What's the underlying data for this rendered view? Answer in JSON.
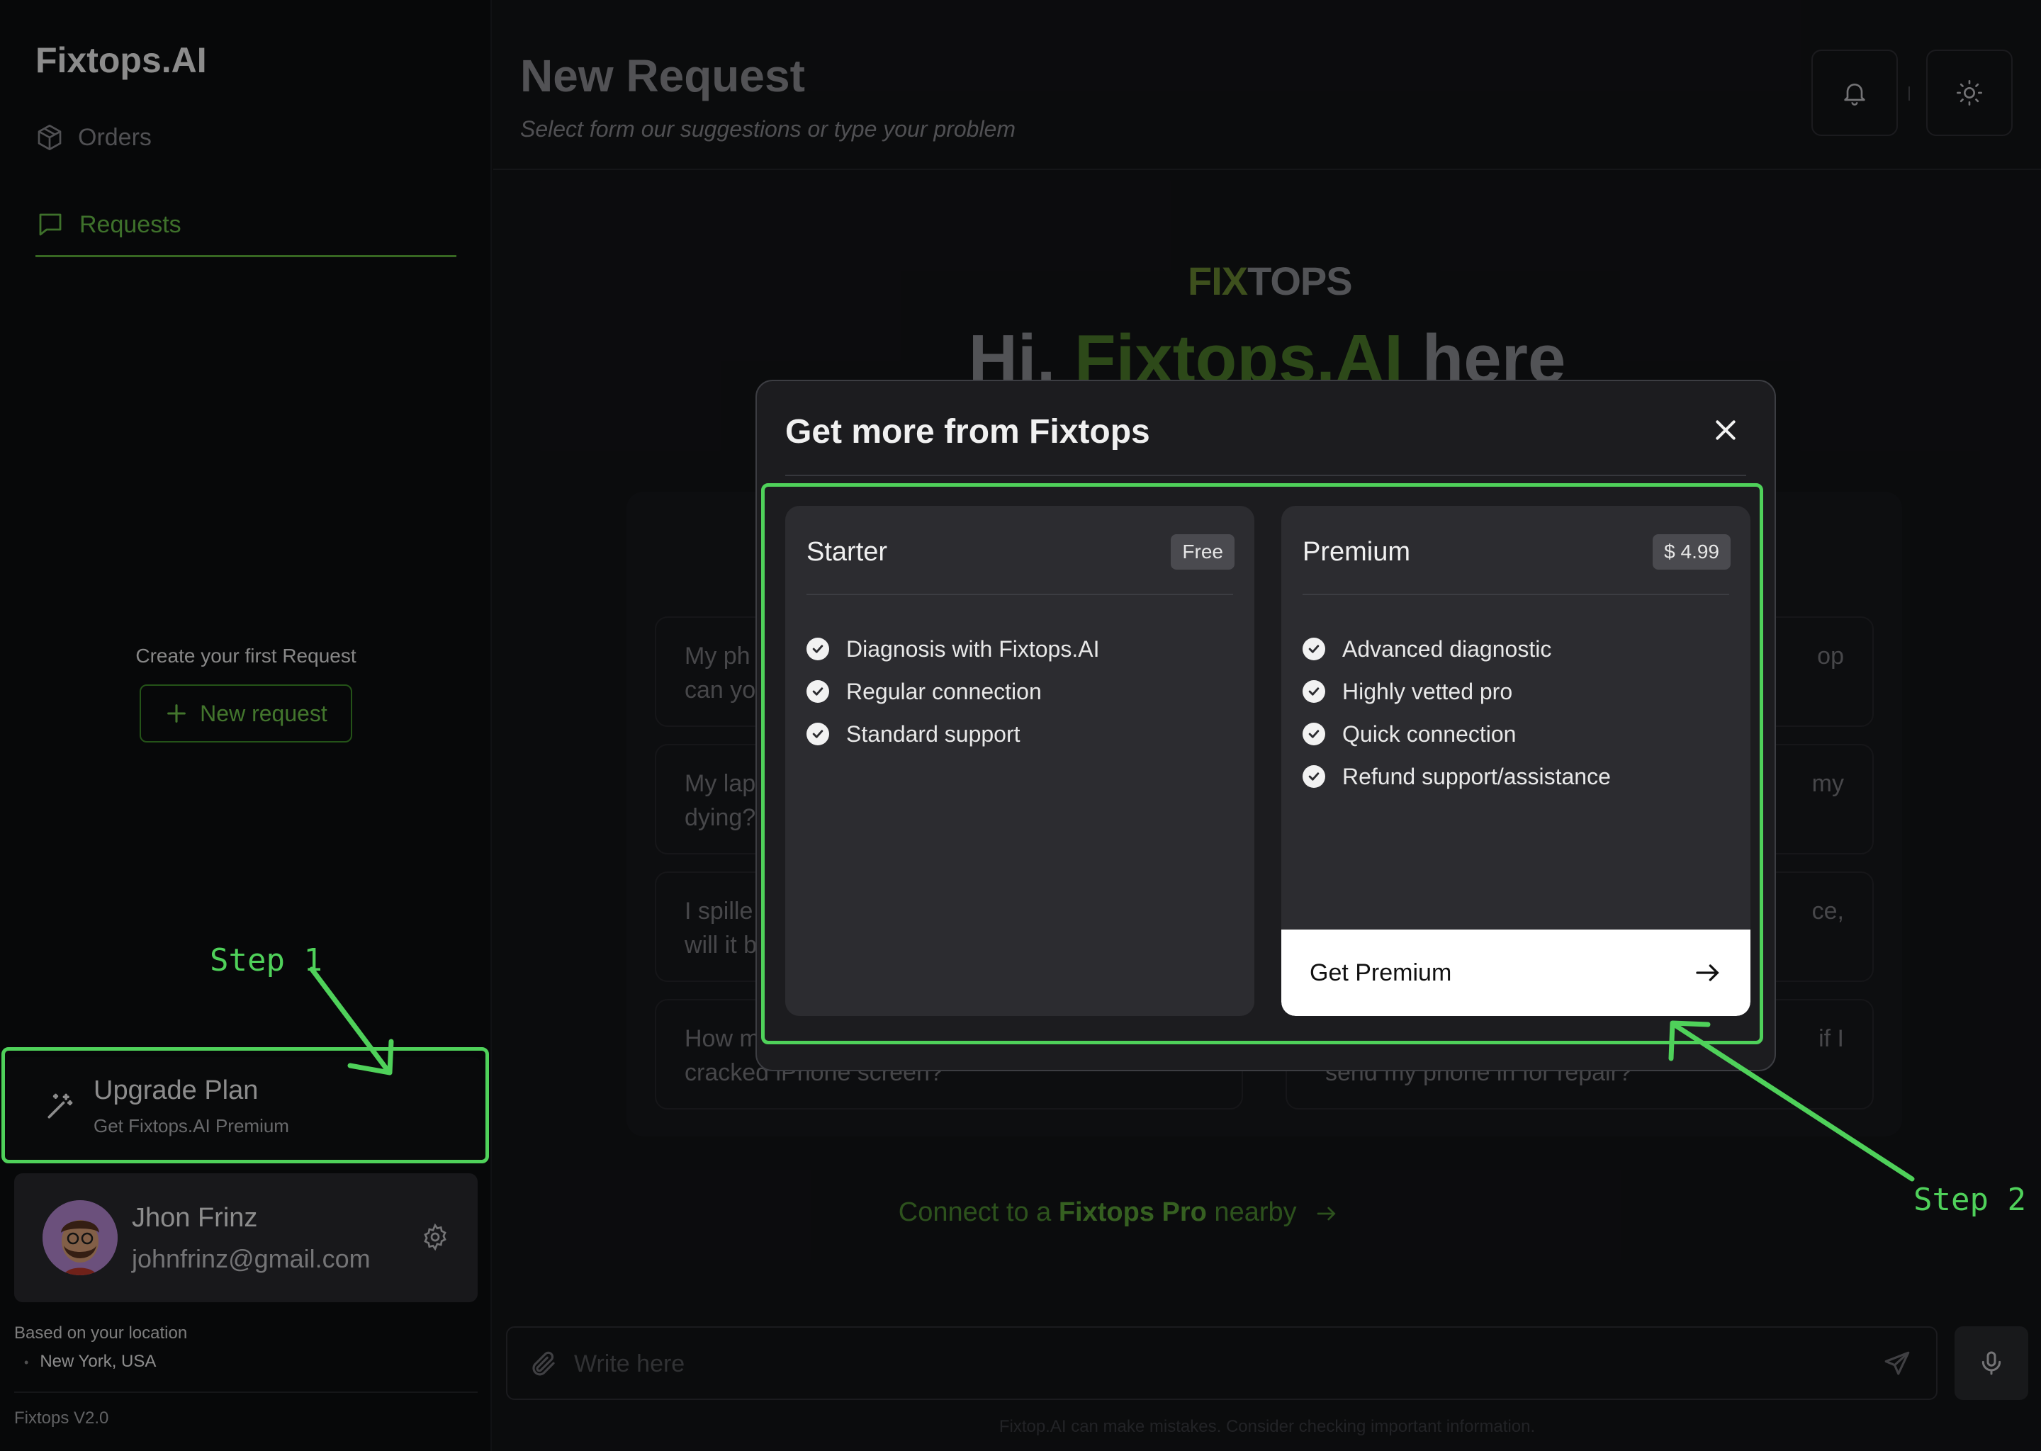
{
  "sidebar": {
    "brand": "Fixtops.AI",
    "nav": [
      {
        "label": "Orders",
        "icon": "box-icon",
        "active": false
      },
      {
        "label": "Requests",
        "icon": "chat-bubble-icon",
        "active": true
      }
    ],
    "empty_state": {
      "title": "Create your first Request",
      "button_label": "New request"
    },
    "upgrade": {
      "title": "Upgrade Plan",
      "subtitle": "Get Fixtops.AI Premium"
    },
    "user": {
      "name": "Jhon Frinz",
      "email": "johnfrinz@gmail.com"
    },
    "location": {
      "label": "Based on your location",
      "value": "New York, USA"
    },
    "version": "Fixtops V2.0"
  },
  "header": {
    "title": "New Request",
    "subtitle": "Select form our suggestions or type your problem"
  },
  "main": {
    "logo_f": "FIX",
    "logo_rest": "TOPS",
    "hero_prefix": "Hi, ",
    "hero_accent": "Fixtops.AI",
    "hero_suffix": " here",
    "suggestions": [
      {
        "left": "My ph",
        "left2": "can yo",
        "right": "op",
        "right2": ""
      },
      {
        "left": "My lap",
        "left2": "dying?",
        "right": "my",
        "right2": ""
      },
      {
        "left": "I spille",
        "left2": "will it b",
        "right": "ce,",
        "right2": ""
      },
      {
        "left": "How m",
        "left2": "cracked iPhone screen?",
        "right": "if I",
        "right2": "send my phone in for repair?"
      }
    ],
    "connect": {
      "prefix": "Connect to a ",
      "bold": "Fixtops Pro",
      "suffix": " nearby"
    },
    "input": {
      "placeholder": "Write here"
    },
    "disclaimer": "Fixtop.AI can make mistakes. Consider checking important information."
  },
  "modal": {
    "title": "Get more from Fixtops",
    "plans": [
      {
        "name": "Starter",
        "badge": "Free",
        "features": [
          "Diagnosis with Fixtops.AI",
          "Regular connection",
          "Standard support"
        ]
      },
      {
        "name": "Premium",
        "badge": "$ 4.99",
        "features": [
          "Advanced diagnostic",
          "Highly vetted pro",
          "Quick connection",
          "Refund support/assistance"
        ],
        "cta": "Get Premium"
      }
    ]
  },
  "annotations": {
    "step1": "Step 1",
    "step2": "Step 2",
    "color": "#4fd15a"
  },
  "colors": {
    "accent": "#6cc34a",
    "background": "#141518",
    "sidebar": "#0d0e10",
    "modal": "#1c1c1f"
  }
}
